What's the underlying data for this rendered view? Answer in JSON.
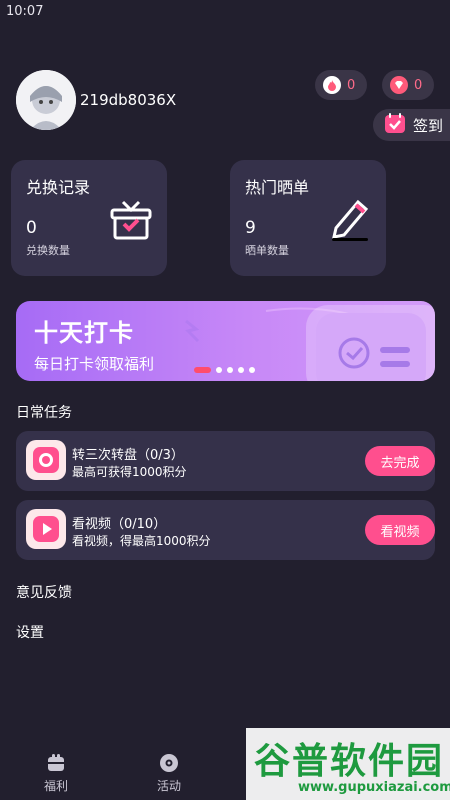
{
  "status_bar": {
    "time": "10:07"
  },
  "profile": {
    "username": "219db8036X"
  },
  "stats": {
    "fire_count": "0",
    "gem_count": "0"
  },
  "signin": {
    "label": "签到"
  },
  "cards": [
    {
      "title": "兑换记录",
      "value": "0",
      "subtitle": "兑换数量",
      "icon": "gift-box-icon"
    },
    {
      "title": "热门晒单",
      "value": "9",
      "subtitle": "晒单数量",
      "icon": "pencil-icon"
    }
  ],
  "banner": {
    "title": "十天打卡",
    "subtitle": "每日打卡领取福利",
    "slide_count": 5,
    "active_slide": 0
  },
  "daily_tasks": {
    "section_title": "日常任务",
    "items": [
      {
        "name": "转三次转盘（0/3）",
        "desc": "最高可获得1000积分",
        "button": "去完成",
        "icon": "wheel-icon"
      },
      {
        "name": "看视频（0/10）",
        "desc": "看视频，得最高1000积分",
        "button": "看视频",
        "icon": "play-icon"
      }
    ]
  },
  "menu": {
    "feedback": "意见反馈",
    "settings": "设置"
  },
  "tabbar": {
    "tabs": [
      {
        "label": "福利",
        "icon": "gift-icon"
      },
      {
        "label": "活动",
        "icon": "disc-icon"
      }
    ]
  },
  "watermark": {
    "title": "谷普软件园",
    "url": "www.gupuxiazai.com"
  },
  "colors": {
    "background": "#221f2e",
    "card": "#35314a",
    "accent": "#ff4f8e",
    "banner_start": "#a66bf5",
    "banner_end": "#d39cf9"
  }
}
